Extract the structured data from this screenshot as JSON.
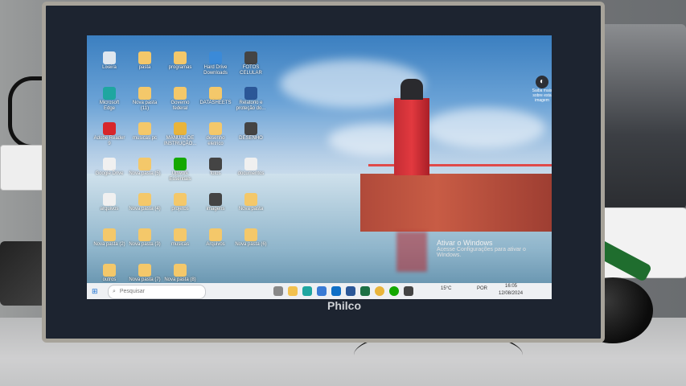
{
  "monitor": {
    "brand": "Philco"
  },
  "desktop_icons": [
    {
      "label": "Lixeira",
      "glyph": "recycle-bin-icon",
      "color": "#dfe7ef"
    },
    {
      "label": "pasta",
      "glyph": "folder-icon",
      "color": "#f4c86a"
    },
    {
      "label": "programas",
      "glyph": "folder-icon",
      "color": "#f4c86a"
    },
    {
      "label": "Hard Drive Downloads",
      "glyph": "drive-icon",
      "color": "#3b8ad8"
    },
    {
      "label": "FOTOS CELULAR",
      "glyph": "image-icon",
      "color": "#444444"
    },
    {
      "label": "Microsoft Edge",
      "glyph": "edge-icon",
      "color": "#1fa6a0"
    },
    {
      "label": "Nova pasta (11)",
      "glyph": "folder-icon",
      "color": "#f4c86a"
    },
    {
      "label": "Governo federal",
      "glyph": "folder-icon",
      "color": "#f4c86a"
    },
    {
      "label": "DATASHEETS",
      "glyph": "folder-icon",
      "color": "#f4c86a"
    },
    {
      "label": "Relatorio e proteção do...",
      "glyph": "word-doc-icon",
      "color": "#2b5797"
    },
    {
      "label": "Adobe Reader 9",
      "glyph": "pdf-icon",
      "color": "#d7262b"
    },
    {
      "label": "musicas pc",
      "glyph": "folder-icon",
      "color": "#f4c86a"
    },
    {
      "label": "MANUAL DE INSTRUÇÃO...",
      "glyph": "chrome-icon",
      "color": "#e9b43a"
    },
    {
      "label": "desenho eletrico",
      "glyph": "folder-icon",
      "color": "#f4c86a"
    },
    {
      "label": "DESENHO",
      "glyph": "image-icon",
      "color": "#444444"
    },
    {
      "label": "Google Drive",
      "glyph": "file-icon",
      "color": "#f0f0f0"
    },
    {
      "label": "Nova pasta (5)",
      "glyph": "folder-icon",
      "color": "#f4c86a"
    },
    {
      "label": "Upwork Essentials",
      "glyph": "upwork-icon",
      "color": "#14a800"
    },
    {
      "label": "fotos",
      "glyph": "image-icon",
      "color": "#444444"
    },
    {
      "label": "documentos",
      "glyph": "file-icon",
      "color": "#f0f0f0"
    },
    {
      "label": "arquivos",
      "glyph": "file-icon",
      "color": "#f0f0f0"
    },
    {
      "label": "Nova pasta (4)",
      "glyph": "folder-icon",
      "color": "#f4c86a"
    },
    {
      "label": "projetos",
      "glyph": "folder-icon",
      "color": "#f4c86a"
    },
    {
      "label": "imagens",
      "glyph": "image-icon",
      "color": "#444444"
    },
    {
      "label": "Nova pasta",
      "glyph": "folder-icon",
      "color": "#f4c86a"
    },
    {
      "label": "Nova pasta (2)",
      "glyph": "folder-icon",
      "color": "#f4c86a"
    },
    {
      "label": "Nova pasta (3)",
      "glyph": "folder-icon",
      "color": "#f4c86a"
    },
    {
      "label": "musicas",
      "glyph": "folder-icon",
      "color": "#f4c86a"
    },
    {
      "label": "Arquivos",
      "glyph": "folder-icon",
      "color": "#f4c86a"
    },
    {
      "label": "Nova pasta (6)",
      "glyph": "folder-icon",
      "color": "#f4c86a"
    },
    {
      "label": "outros",
      "glyph": "folder-icon",
      "color": "#f4c86a"
    },
    {
      "label": "Nova pasta (7)",
      "glyph": "folder-icon",
      "color": "#f4c86a"
    },
    {
      "label": "Nova pasta (8)",
      "glyph": "folder-icon",
      "color": "#f4c86a"
    }
  ],
  "notification_widget": {
    "label": "Saiba mais sobre esta imagem"
  },
  "watermark": {
    "title": "Ativar o Windows",
    "subtitle": "Acesse Configurações para ativar o Windows."
  },
  "taskbar": {
    "search_placeholder": "Pesquisar",
    "weather": "15°C",
    "language": "POR",
    "time": "16:05",
    "date": "12/08/2024"
  }
}
